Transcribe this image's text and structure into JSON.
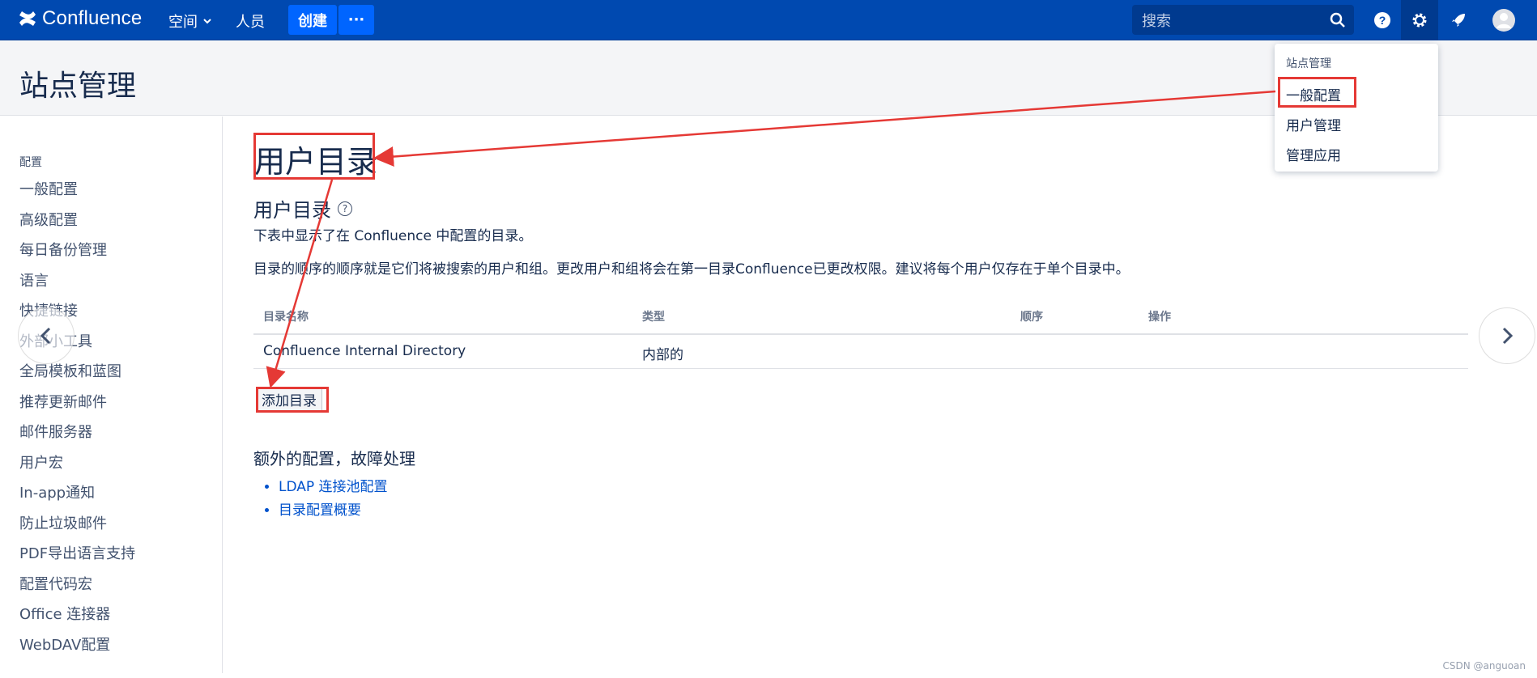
{
  "topbar": {
    "logo_text": "Confluence",
    "spaces_label": "空间",
    "people_label": "人员",
    "create_label": "创建",
    "more_label": "···",
    "search_placeholder": "搜索"
  },
  "page_title": "站点管理",
  "sidebar": {
    "heading": "配置",
    "items": [
      "一般配置",
      "高级配置",
      "每日备份管理",
      "语言",
      "快捷链接",
      "外部小工具",
      "全局模板和蓝图",
      "推荐更新邮件",
      "邮件服务器",
      "用户宏",
      "In-app通知",
      "防止垃圾邮件",
      "PDF导出语言支持",
      "配置代码宏",
      "Office 连接器",
      "WebDAV配置"
    ]
  },
  "main": {
    "big_title": "用户目录",
    "section_title": "用户目录",
    "help_symbol": "?",
    "description_1": "下表中显示了在 Confluence 中配置的目录。",
    "description_2": "目录的顺序的顺序就是它们将被搜索的用户和组。更改用户和组将会在第一目录Confluence已更改权限。建议将每个用户仅存在于单个目录中。",
    "table": {
      "headers": [
        "目录名称",
        "类型",
        "顺序",
        "操作"
      ],
      "rows": [
        {
          "name": "Confluence Internal Directory",
          "type": "内部的",
          "order": "",
          "actions": ""
        }
      ]
    },
    "add_button": "添加目录",
    "extra_title": "额外的配置，故障处理",
    "extra_links": [
      "LDAP 连接池配置",
      "目录配置概要"
    ]
  },
  "dropdown": {
    "heading": "站点管理",
    "items": [
      "一般配置",
      "用户管理",
      "管理应用"
    ]
  },
  "watermark": "CSDN @anguoan",
  "colors": {
    "topbar": "#0049b0",
    "create": "#0065ff",
    "annotation": "#e53935",
    "link": "#0052cc"
  }
}
